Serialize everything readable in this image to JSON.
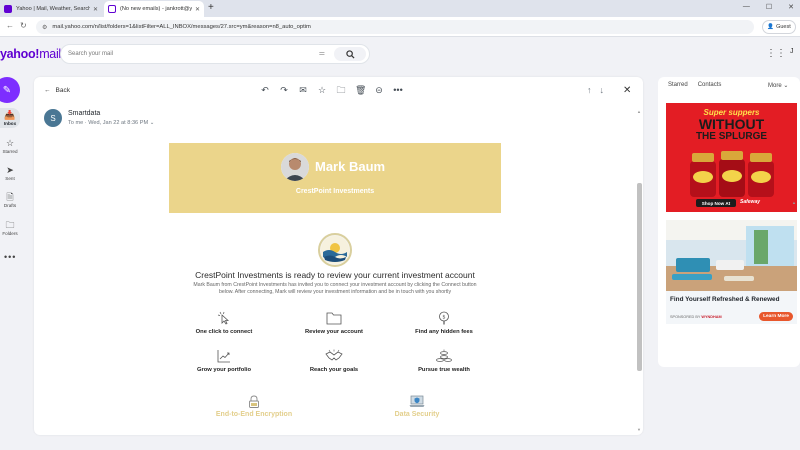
{
  "browser": {
    "tabs": [
      {
        "title": "Yahoo | Mail, Weather, Search",
        "active": false
      },
      {
        "title": "(No new emails) - jankrott@yah",
        "active": true
      }
    ],
    "url": "mail.yahoo.com/n/list/folders=1&listFilter=ALL_INBOX/messages/27.src=ym&reason=n8_auto_optim",
    "profile_label": "Guest"
  },
  "header": {
    "logo_main": "yahoo!",
    "logo_mail": "mail",
    "search_placeholder": "Search your mail",
    "avatar_initial": "J"
  },
  "rail": {
    "items": [
      {
        "label": "Inbox",
        "icon": "inbox-icon"
      },
      {
        "label": "Starred",
        "icon": "star-icon"
      },
      {
        "label": "Sent",
        "icon": "send-icon"
      },
      {
        "label": "Drafts",
        "icon": "draft-icon"
      },
      {
        "label": "Folders",
        "icon": "folder-icon"
      }
    ]
  },
  "message": {
    "back_label": "Back",
    "sender_initial": "S",
    "sender_name": "Smartdata",
    "meta": "To me · Wed, Jan 22 at 8:36 PM"
  },
  "email": {
    "person_name": "Mark Baum",
    "company": "CrestPoint Investments",
    "headline": "CrestPoint Investments is ready to review your current investment account",
    "body_line1": "Mark Baum from CrestPoint Investments has invited you to connect your investment account by clicking the Connect button",
    "body_line2": "below. After connecting, Mark will review your investment information and be in touch with you shortly",
    "features": [
      {
        "label": "One click to connect",
        "icon": "cursor-click-icon"
      },
      {
        "label": "Review your account",
        "icon": "folder-icon"
      },
      {
        "label": "Find any hidden fees",
        "icon": "magnifier-dollar-icon"
      },
      {
        "label": "Grow your portfolio",
        "icon": "growth-chart-icon"
      },
      {
        "label": "Reach your goals",
        "icon": "handshake-icon"
      },
      {
        "label": "Pursue true wealth",
        "icon": "coins-stack-icon"
      }
    ],
    "security": [
      {
        "label": "End-to-End Encryption",
        "icon": "padlock-icon"
      },
      {
        "label": "Data Security",
        "icon": "laptop-shield-icon"
      }
    ],
    "accent_color": "#ebd58b"
  },
  "right_panel": {
    "tab_starred": "Starred",
    "tab_contacts": "Contacts",
    "more_label": "More",
    "ad1": {
      "line1": "Super suppers",
      "line2": "WITHOUT",
      "line3": "THE SPLURGE",
      "cta": "Shop Now At",
      "store": "Safeway"
    },
    "ad2": {
      "title": "Find Yourself Refreshed & Renewed",
      "sponsored": "SPONSORED BY",
      "sponsor": "WYNDHAM",
      "cta": "Learn More"
    }
  }
}
